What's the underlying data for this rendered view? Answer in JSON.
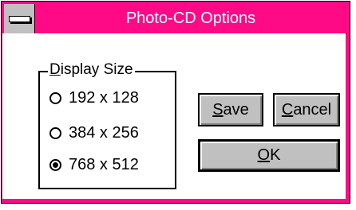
{
  "window": {
    "title": "Photo-CD Options",
    "colors": {
      "title_bar": "#ff0a86",
      "button_face": "#c0c0c0"
    }
  },
  "group": {
    "label_mnemonic": "D",
    "label_rest": "isplay Size",
    "options": [
      {
        "label": "192 x 128",
        "selected": false
      },
      {
        "label": "384 x 256",
        "selected": false
      },
      {
        "label": "768 x 512",
        "selected": true
      }
    ]
  },
  "buttons": {
    "save": {
      "mnemonic": "S",
      "rest": "ave"
    },
    "cancel": {
      "mnemonic": "C",
      "rest": "ancel"
    },
    "ok": {
      "mnemonic": "O",
      "rest": "K"
    }
  },
  "icons": {
    "system_menu": "system-menu-icon"
  }
}
